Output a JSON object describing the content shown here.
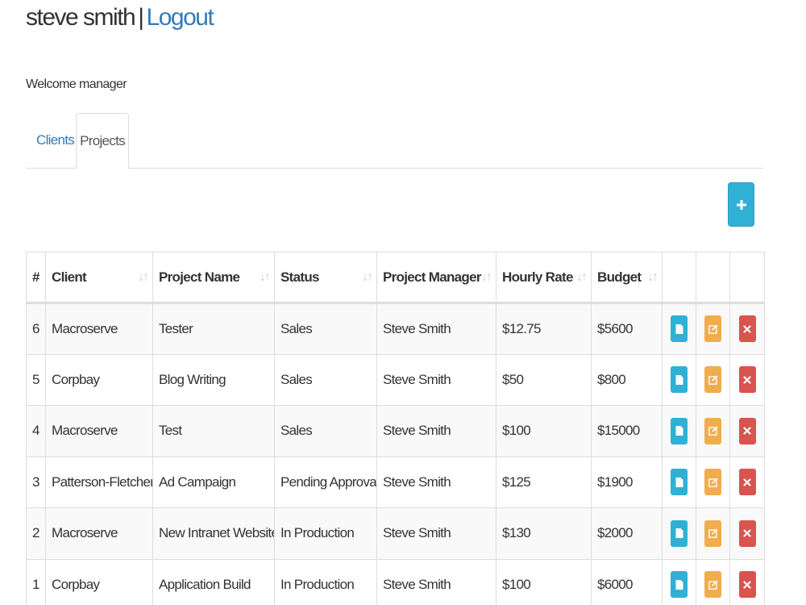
{
  "header": {
    "user_name": "steve smith",
    "separator": "|",
    "logout_label": "Logout"
  },
  "welcome": "Welcome manager",
  "tabs": [
    {
      "label": "Clients"
    },
    {
      "label": "Projects"
    }
  ],
  "active_tab": "Projects",
  "add_button": {
    "icon": "plus-icon"
  },
  "table": {
    "columns": [
      "#",
      "Client",
      "Project Name",
      "Status",
      "Project Manager",
      "Hourly Rate",
      "Budget"
    ],
    "sort_icon": "sort-icon",
    "row_actions": [
      "view",
      "edit",
      "delete"
    ],
    "rows": [
      {
        "id": "6",
        "client": "Macroserve",
        "project": "Tester",
        "status": "Sales",
        "manager": "Steve Smith",
        "rate": "$12.75",
        "budget": "$5600"
      },
      {
        "id": "5",
        "client": "Corpbay",
        "project": "Blog Writing",
        "status": "Sales",
        "manager": "Steve Smith",
        "rate": "$50",
        "budget": "$800"
      },
      {
        "id": "4",
        "client": "Macroserve",
        "project": "Test",
        "status": "Sales",
        "manager": "Steve Smith",
        "rate": "$100",
        "budget": "$15000"
      },
      {
        "id": "3",
        "client": "Patterson-Fletcher",
        "project": "Ad Campaign",
        "status": "Pending Approval",
        "manager": "Steve Smith",
        "rate": "$125",
        "budget": "$1900"
      },
      {
        "id": "2",
        "client": "Macroserve",
        "project": "New Intranet Website",
        "status": "In Production",
        "manager": "Steve Smith",
        "rate": "$130",
        "budget": "$2000"
      },
      {
        "id": "1",
        "client": "Corpbay",
        "project": "Application Build",
        "status": "In Production",
        "manager": "Steve Smith",
        "rate": "$100",
        "budget": "$6000"
      }
    ]
  },
  "colors": {
    "link": "#337ab7",
    "info": "#31b0d5",
    "warning": "#f0ad4e",
    "danger": "#d9534f",
    "border": "#dddddd"
  }
}
